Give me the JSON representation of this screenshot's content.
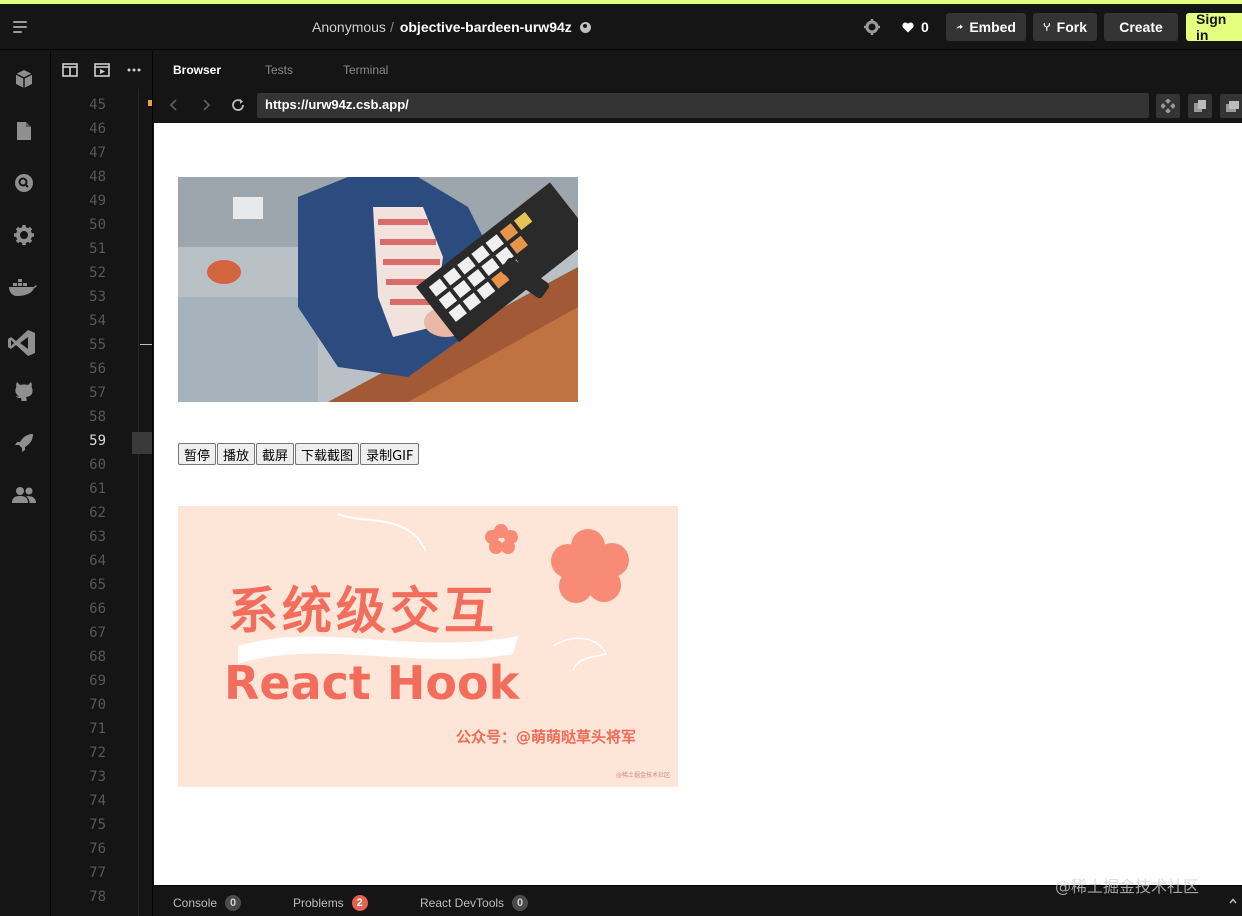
{
  "header": {
    "owner": "Anonymous",
    "separator": "/",
    "sandbox_name": "objective-bardeen-urw94z",
    "likes": "0",
    "embed_label": "Embed",
    "fork_label": "Fork",
    "create_label": "Create",
    "signin_label": "Sign in",
    "accent_color": "#e5ff7f"
  },
  "activity_bar": {
    "icons": [
      "cube-icon",
      "file-icon",
      "search-icon",
      "gear-icon",
      "docker-icon",
      "vscode-icon",
      "github-icon",
      "rocket-icon",
      "users-icon"
    ]
  },
  "editor": {
    "line_numbers": [
      "45",
      "46",
      "47",
      "48",
      "49",
      "50",
      "51",
      "52",
      "53",
      "54",
      "55",
      "56",
      "57",
      "58",
      "59",
      "60",
      "61",
      "62",
      "63",
      "64",
      "65",
      "66",
      "67",
      "68",
      "69",
      "70",
      "71",
      "72",
      "73",
      "74",
      "75",
      "76",
      "77",
      "78"
    ],
    "active_line": "59"
  },
  "pane": {
    "tabs": [
      "Browser",
      "Tests",
      "Terminal"
    ],
    "url": "https://urw94z.csb.app/"
  },
  "page": {
    "buttons": [
      "暂停",
      "播放",
      "截屏",
      "下载截图",
      "录制GIF"
    ],
    "poster_title": "系统级交互",
    "poster_subtitle": "React Hook",
    "poster_credit": "公众号：@萌萌哒草头将军",
    "poster_small": "@稀土掘金技术社区"
  },
  "bottom_bar": {
    "console_label": "Console",
    "console_count": "0",
    "problems_label": "Problems",
    "problems_count": "2",
    "devtools_label": "React DevTools",
    "devtools_count": "0"
  },
  "watermark": "@稀土掘金技术社区"
}
